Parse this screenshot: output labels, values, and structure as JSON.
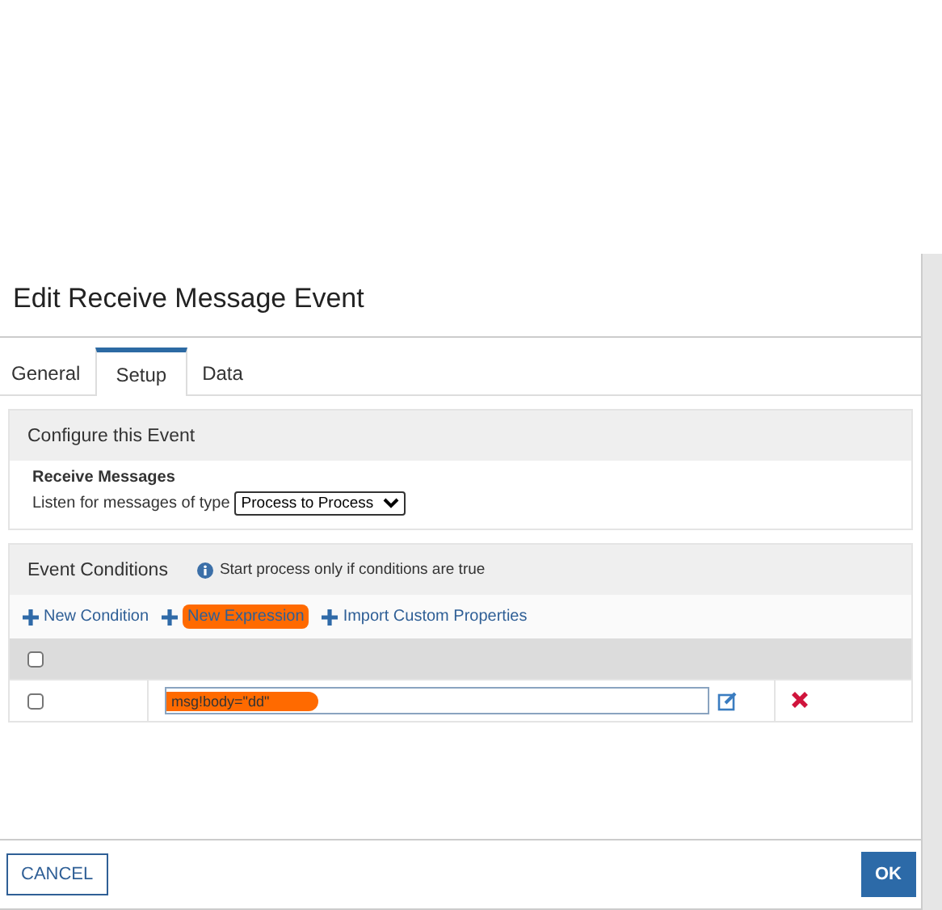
{
  "dialog": {
    "title": "Edit Receive Message Event"
  },
  "tabs": [
    {
      "label": "General",
      "selected": false
    },
    {
      "label": "Setup",
      "selected": true
    },
    {
      "label": "Data",
      "selected": false
    }
  ],
  "configure": {
    "heading": "Configure this Event",
    "subheading": "Receive Messages",
    "label": "Listen for messages of type",
    "select_value": "Process to Process"
  },
  "conditions": {
    "heading": "Event Conditions",
    "info": "Start process only if conditions are true",
    "actions": [
      {
        "label": "New Condition",
        "marked": false
      },
      {
        "label": "New Expression",
        "marked": true
      },
      {
        "label": "Import Custom Properties",
        "marked": false
      }
    ],
    "header_checked": false,
    "rows": [
      {
        "checked": false,
        "expression": "msg!body=\"dd\"",
        "marked": true
      }
    ]
  },
  "buttons": {
    "cancel": "CANCEL",
    "ok": "OK"
  }
}
